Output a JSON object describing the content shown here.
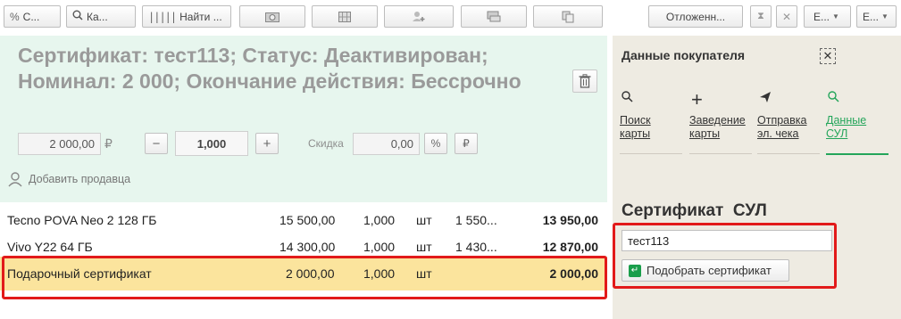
{
  "toolbar": {
    "percent_btn": "С...",
    "search_btn": "Ка...",
    "barcode_btn": "Найти ...",
    "deferred_btn": "Отложенн...",
    "e_btn_1": "Е...",
    "e_btn_2": "Е..."
  },
  "certificate": {
    "title": "Сертификат: тест113; Статус: Деактивирован; Номинал: 2 000; Окончание действия: Бессрочно",
    "price": "2 000,00",
    "currency": "₽",
    "quantity": "1,000",
    "discount_label": "Скидка",
    "discount_value": "0,00",
    "percent_symbol": "%",
    "add_seller": "Добавить продавца"
  },
  "items": [
    {
      "name": "Tecno POVA Neo 2 128 ГБ",
      "price": "15 500,00",
      "qty": "1,000",
      "unit": "шт",
      "discount": "1 550...",
      "sum": "13 950,00"
    },
    {
      "name": "Vivo Y22 64 ГБ",
      "price": "14 300,00",
      "qty": "1,000",
      "unit": "шт",
      "discount": "1 430...",
      "sum": "12 870,00"
    },
    {
      "name": "Подарочный сертификат",
      "price": "2 000,00",
      "qty": "1,000",
      "unit": "шт",
      "discount": "",
      "sum": "2 000,00"
    }
  ],
  "customer_panel": {
    "title": "Данные покупателя",
    "actions": [
      {
        "icon": "search-icon",
        "line1": "Поиск",
        "line2": "карты"
      },
      {
        "icon": "plus-icon",
        "line1": "Заведение",
        "line2": "карты"
      },
      {
        "icon": "send-icon",
        "line1": "Отправка",
        "line2": "эл. чека"
      },
      {
        "icon": "search-icon",
        "line1": "Данные",
        "line2": "СУЛ"
      }
    ],
    "sul_title": "Сертификат  СУЛ",
    "sul_input_value": "тест113",
    "pick_button": "Подобрать сертификат"
  },
  "colors": {
    "header_bg": "#e7f6ee",
    "highlight_row": "#fbe49d",
    "accent_green": "#23a55a",
    "annotation_red": "#e21a1a"
  }
}
